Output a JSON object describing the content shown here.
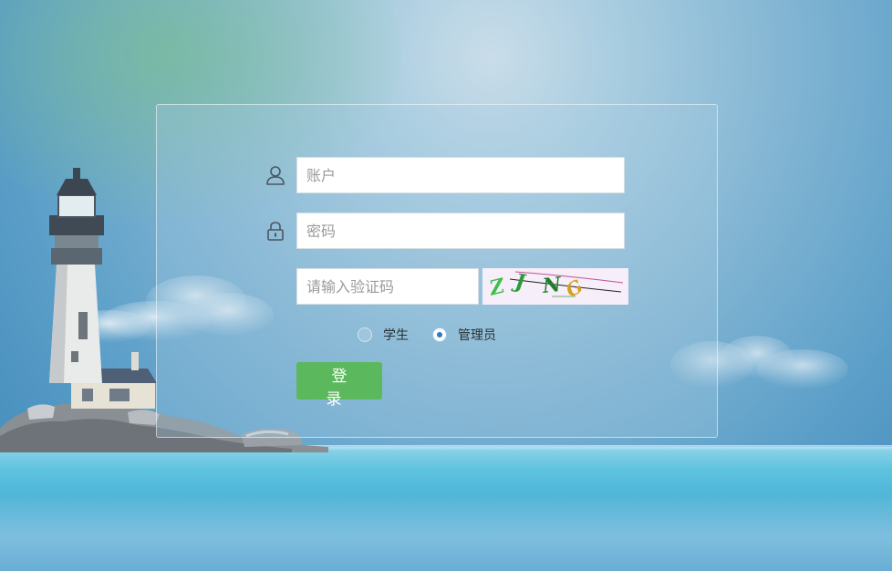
{
  "login_form": {
    "account_placeholder": "账户",
    "password_placeholder": "密码",
    "captcha_placeholder": "请输入验证码",
    "captcha_chars": [
      "Z",
      "J",
      "N",
      "G"
    ],
    "roles": [
      {
        "label": "学生",
        "selected": false
      },
      {
        "label": "管理员",
        "selected": true
      }
    ],
    "login_label": "登 录"
  },
  "colors": {
    "login_button": "#5cb85c",
    "radio_selected": "#2e7bbf"
  },
  "icons": {
    "account": "user-icon",
    "password": "lock-icon"
  }
}
